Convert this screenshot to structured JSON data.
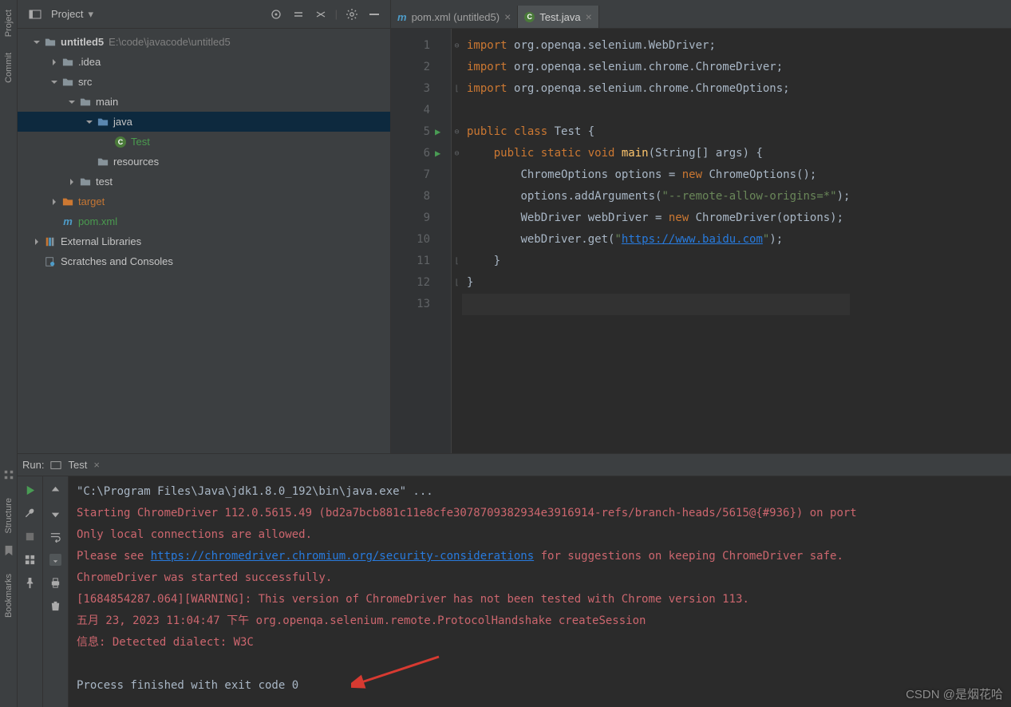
{
  "rails": {
    "project": "Project",
    "commit": "Commit",
    "structure": "Structure",
    "bookmarks": "Bookmarks"
  },
  "projectHeader": {
    "label": "Project"
  },
  "tree": {
    "root": {
      "name": "untitled5",
      "path": "E:\\code\\javacode\\untitled5"
    },
    "idea": ".idea",
    "src": "src",
    "main": "main",
    "java": "java",
    "testClass": "Test",
    "resources": "resources",
    "testDir": "test",
    "target": "target",
    "pom": "pom.xml",
    "ext": "External Libraries",
    "scratch": "Scratches and Consoles"
  },
  "tabs": [
    {
      "label": "pom.xml (untitled5)",
      "active": false,
      "icon": "m"
    },
    {
      "label": "Test.java",
      "active": true,
      "icon": "c"
    }
  ],
  "code": {
    "lines": [
      "import org.openqa.selenium.WebDriver;",
      "import org.openqa.selenium.chrome.ChromeDriver;",
      "import org.openqa.selenium.chrome.ChromeOptions;",
      "",
      "public class Test {",
      "    public static void main(String[] args) {",
      "        ChromeOptions options = new ChromeOptions();",
      "        options.addArguments(\"--remote-allow-origins=*\");",
      "        WebDriver webDriver = new ChromeDriver(options);",
      "        webDriver.get(\"https://www.baidu.com\");",
      "    }",
      "}",
      ""
    ],
    "url": "https://www.baidu.com"
  },
  "run": {
    "label": "Run:",
    "config": "Test"
  },
  "console": {
    "line1": "\"C:\\Program Files\\Java\\jdk1.8.0_192\\bin\\java.exe\" ...",
    "line2": "Starting ChromeDriver 112.0.5615.49 (bd2a7bcb881c11e8cfe3078709382934e3916914-refs/branch-heads/5615@{#936}) on port",
    "line3": "Only local connections are allowed.",
    "line4a": "Please see ",
    "line4link": "https://chromedriver.chromium.org/security-considerations",
    "line4b": " for suggestions on keeping ChromeDriver safe.",
    "line5": "ChromeDriver was started successfully.",
    "line6": "[1684854287.064][WARNING]: This version of ChromeDriver has not been tested with Chrome version 113.",
    "line7": "五月 23, 2023 11:04:47 下午 org.openqa.selenium.remote.ProtocolHandshake createSession",
    "line8": "信息: Detected dialect: W3C",
    "line9": "",
    "line10": "Process finished with exit code 0"
  },
  "watermark": "CSDN @是烟花哈"
}
